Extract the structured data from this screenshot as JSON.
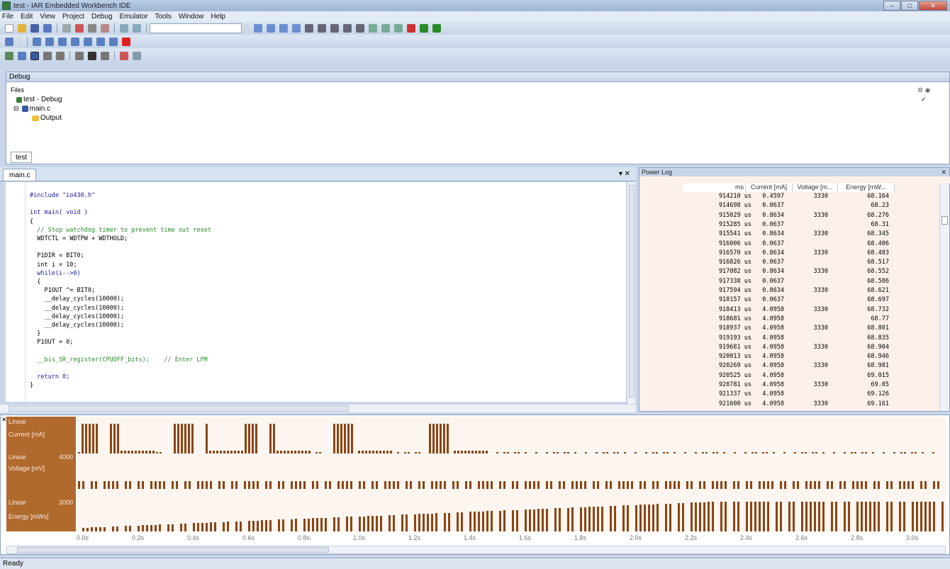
{
  "title": "test - IAR Embedded Workbench IDE",
  "menu": [
    "File",
    "Edit",
    "View",
    "Project",
    "Debug",
    "Emulator",
    "Tools",
    "Window",
    "Help"
  ],
  "workspace": {
    "title": "Debug",
    "files_header": "Files",
    "project": "test - Debug",
    "file": "main.c",
    "folder": "Output",
    "tab": "test"
  },
  "editor": {
    "tab": "main.c",
    "lines": [
      {
        "t": "#include \"io430.h\"",
        "c": "kw"
      },
      {
        "t": "",
        "c": ""
      },
      {
        "t": "int main( void )",
        "c": "kw"
      },
      {
        "t": "{",
        "c": ""
      },
      {
        "t": "  // Stop watchdog timer to prevent time out reset",
        "c": "cm"
      },
      {
        "t": "  WDTCTL = WDTPW + WDTHOLD;",
        "c": ""
      },
      {
        "t": "",
        "c": ""
      },
      {
        "t": "  P1DIR = BIT0;",
        "c": ""
      },
      {
        "t": "  int i = 10;",
        "c": ""
      },
      {
        "t": "  while(i-->0)",
        "c": "kw"
      },
      {
        "t": "  {",
        "c": ""
      },
      {
        "t": "    P1OUT ^= BIT0;",
        "c": ""
      },
      {
        "t": "    __delay_cycles(10000);",
        "c": ""
      },
      {
        "t": "    __delay_cycles(10000);",
        "c": ""
      },
      {
        "t": "    __delay_cycles(10000);",
        "c": ""
      },
      {
        "t": "    __delay_cycles(10000);",
        "c": ""
      },
      {
        "t": "  }",
        "c": ""
      },
      {
        "t": "  P1OUT = 0;",
        "c": ""
      },
      {
        "t": "",
        "c": ""
      },
      {
        "t": "  __bis_SR_register(CPUOFF_bits);    // Enter LPM",
        "c": "cm"
      },
      {
        "t": "",
        "c": ""
      },
      {
        "t": "  return 0;",
        "c": "kw"
      },
      {
        "t": "}",
        "c": ""
      }
    ]
  },
  "power": {
    "title": "Power Log",
    "columns": [
      "ms",
      "Current [mA]",
      "Voltage [m...",
      "Energy [mW..."
    ],
    "rows": [
      [
        "914210 us",
        "0.4597",
        "3330",
        "68.164"
      ],
      [
        "914698 us",
        "0.0637",
        "",
        "68.23"
      ],
      [
        "915029 us",
        "0.8634",
        "3330",
        "68.276"
      ],
      [
        "915285 us",
        "0.0637",
        "",
        "68.31"
      ],
      [
        "915541 us",
        "0.8634",
        "3330",
        "68.345"
      ],
      [
        "916006 us",
        "0.0637",
        "",
        "68.406"
      ],
      [
        "916570 us",
        "0.8634",
        "3330",
        "68.483"
      ],
      [
        "916826 us",
        "0.0637",
        "",
        "68.517"
      ],
      [
        "917082 us",
        "0.8634",
        "3330",
        "68.552"
      ],
      [
        "917338 us",
        "0.0637",
        "",
        "68.586"
      ],
      [
        "917594 us",
        "0.8634",
        "3330",
        "68.621"
      ],
      [
        "918157 us",
        "0.0637",
        "",
        "68.697"
      ],
      [
        "918413 us",
        "4.0958",
        "3330",
        "68.732"
      ],
      [
        "918681 us",
        "4.0958",
        "",
        "68.77"
      ],
      [
        "918937 us",
        "4.0958",
        "3330",
        "68.801"
      ],
      [
        "919193 us",
        "4.0958",
        "",
        "68.835"
      ],
      [
        "919681 us",
        "4.0958",
        "3330",
        "68.904"
      ],
      [
        "920013 us",
        "4.0958",
        "",
        "68.946"
      ],
      [
        "920269 us",
        "4.0958",
        "3330",
        "68.981"
      ],
      [
        "920525 us",
        "4.0958",
        "",
        "69.015"
      ],
      [
        "920781 us",
        "4.0958",
        "3330",
        "69.05"
      ],
      [
        "921337 us",
        "4.0958",
        "",
        "69.126"
      ],
      [
        "921600 us",
        "4.0958",
        "3330",
        "69.161"
      ]
    ]
  },
  "timeline": {
    "tracks": [
      {
        "scale": "Linear",
        "name": "Current [mA]",
        "tag": ""
      },
      {
        "scale": "Linear",
        "name": "Voltage [mV]",
        "tag": "4000"
      },
      {
        "scale": "Linear",
        "name": "Energy [mWs]",
        "tag": "3000"
      }
    ],
    "ticks": [
      "0.0s",
      "0.2s",
      "0.4s",
      "0.6s",
      "0.8s",
      "1.0s",
      "1.2s",
      "1.4s",
      "1.6s",
      "1.8s",
      "2.0s",
      "2.2s",
      "2.4s",
      "2.6s",
      "2.8s",
      "3.0s"
    ]
  },
  "status": "Ready"
}
